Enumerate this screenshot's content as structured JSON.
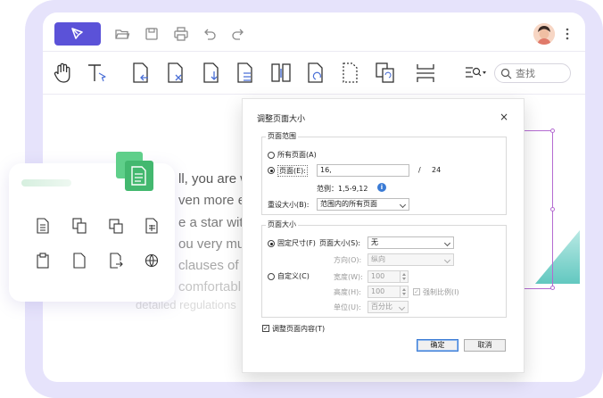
{
  "colors": {
    "frame": "#e6e3fb",
    "brand": "#5b52d8",
    "selection": "#b46bd1",
    "accent_teal": "#62c8c0",
    "accent_green": "#4cc07a"
  },
  "title_bar": {
    "icons": [
      "pen-logo-icon",
      "folder-open-icon",
      "save-icon",
      "print-icon",
      "undo-icon",
      "redo-icon",
      "avatar",
      "more-vertical-icon"
    ]
  },
  "toolbar": {
    "tools": [
      "hand-tool-icon",
      "text-select-icon",
      "insert-page-icon",
      "delete-page-icon",
      "extract-page-icon",
      "replace-page-icon",
      "split-page-icon",
      "rotate-page-icon",
      "crop-page-icon",
      "duplicate-page-icon",
      "page-break-icon"
    ],
    "search_placeholder": "查找"
  },
  "document": {
    "lines": [
      "ll, you are w",
      "ven more e",
      "e a star with",
      "ou very muc",
      "clauses of s",
      "comfortabl",
      "detailed regulations"
    ]
  },
  "dialog": {
    "title": "调整页面大小",
    "close": "×",
    "page_range": {
      "legend": "页面范围",
      "all_pages": "所有页面(A)",
      "pages_label": "页面(E):",
      "pages_value": "16,",
      "total_separator": "/",
      "total_pages": "24",
      "example": "范例：1,5-9,12",
      "resize_label": "重设大小(B):",
      "resize_value": "范围内的所有页面"
    },
    "page_size": {
      "legend": "页面大小",
      "fixed_size": "固定尺寸(F)",
      "size_label": "页面大小(S):",
      "size_value": "无",
      "orientation_label": "方向(O):",
      "orientation_value": "纵向",
      "custom": "自定义(C)",
      "width_label": "宽度(W):",
      "width_value": "100",
      "height_label": "高度(H):",
      "height_value": "100",
      "keep_ratio": "强制比例(I)",
      "unit_label": "单位(U):",
      "unit_value": "百分比"
    },
    "adjust_content": "调整页面内容(T)",
    "ok": "确定",
    "cancel": "取消"
  },
  "float_panel": {
    "icons": [
      "document-lines-icon",
      "copy-pages-icon",
      "duplicate-icon",
      "table-page-icon",
      "clipboard-icon",
      "blank-page-icon",
      "export-page-icon",
      "globe-page-icon"
    ]
  }
}
